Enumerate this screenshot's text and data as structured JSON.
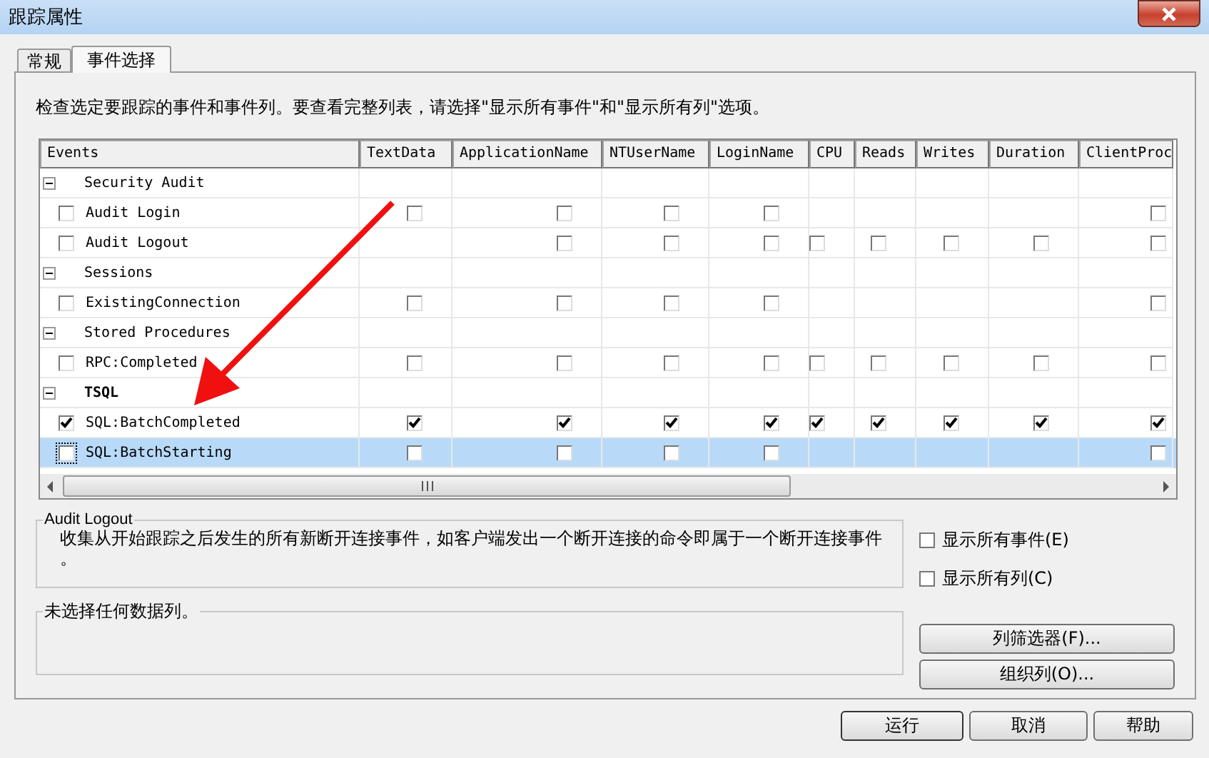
{
  "window": {
    "title": "跟踪属性"
  },
  "tabs": [
    {
      "label": "常规",
      "selected": false
    },
    {
      "label": "事件选择",
      "selected": true
    }
  ],
  "instructions": "检查选定要跟踪的事件和事件列。要查看完整列表，请选择\"显示所有事件\"和\"显示所有列\"选项。",
  "table": {
    "columns": [
      "Events",
      "TextData",
      "ApplicationName",
      "NTUserName",
      "LoginName",
      "CPU",
      "Reads",
      "Writes",
      "Duration",
      "ClientProc"
    ],
    "rows": [
      {
        "kind": "category",
        "label": "Security Audit",
        "expanded": true,
        "bold": false,
        "selected": false
      },
      {
        "kind": "event",
        "label": "Audit Login",
        "checked": false,
        "selected": false,
        "cells": [
          {
            "kind": "box",
            "checked": false
          },
          {
            "kind": "box",
            "checked": false
          },
          {
            "kind": "box",
            "checked": false
          },
          {
            "kind": "box",
            "checked": false
          },
          {
            "kind": "none"
          },
          {
            "kind": "none"
          },
          {
            "kind": "none"
          },
          {
            "kind": "none"
          },
          {
            "kind": "box",
            "checked": false
          }
        ]
      },
      {
        "kind": "event",
        "label": "Audit Logout",
        "checked": false,
        "selected": false,
        "cells": [
          {
            "kind": "none"
          },
          {
            "kind": "box",
            "checked": false
          },
          {
            "kind": "box",
            "checked": false
          },
          {
            "kind": "box",
            "checked": false
          },
          {
            "kind": "box",
            "checked": false
          },
          {
            "kind": "box",
            "checked": false
          },
          {
            "kind": "box",
            "checked": false
          },
          {
            "kind": "box",
            "checked": false
          },
          {
            "kind": "box",
            "checked": false
          }
        ]
      },
      {
        "kind": "category",
        "label": "Sessions",
        "expanded": true,
        "bold": false,
        "selected": false
      },
      {
        "kind": "event",
        "label": "ExistingConnection",
        "checked": false,
        "selected": false,
        "cells": [
          {
            "kind": "box",
            "checked": false
          },
          {
            "kind": "box",
            "checked": false
          },
          {
            "kind": "box",
            "checked": false
          },
          {
            "kind": "box",
            "checked": false
          },
          {
            "kind": "none"
          },
          {
            "kind": "none"
          },
          {
            "kind": "none"
          },
          {
            "kind": "none"
          },
          {
            "kind": "box",
            "checked": false
          }
        ]
      },
      {
        "kind": "category",
        "label": "Stored Procedures",
        "expanded": true,
        "bold": false,
        "selected": false
      },
      {
        "kind": "event",
        "label": "RPC:Completed",
        "checked": false,
        "selected": false,
        "cells": [
          {
            "kind": "box",
            "checked": false
          },
          {
            "kind": "box",
            "checked": false
          },
          {
            "kind": "box",
            "checked": false
          },
          {
            "kind": "box",
            "checked": false
          },
          {
            "kind": "box",
            "checked": false
          },
          {
            "kind": "box",
            "checked": false
          },
          {
            "kind": "box",
            "checked": false
          },
          {
            "kind": "box",
            "checked": false
          },
          {
            "kind": "box",
            "checked": false
          }
        ]
      },
      {
        "kind": "category",
        "label": "TSQL",
        "expanded": true,
        "bold": true,
        "selected": false
      },
      {
        "kind": "event",
        "label": "SQL:BatchCompleted",
        "checked": true,
        "selected": false,
        "cells": [
          {
            "kind": "box",
            "checked": true
          },
          {
            "kind": "box",
            "checked": true
          },
          {
            "kind": "box",
            "checked": true
          },
          {
            "kind": "box",
            "checked": true
          },
          {
            "kind": "box",
            "checked": true
          },
          {
            "kind": "box",
            "checked": true
          },
          {
            "kind": "box",
            "checked": true
          },
          {
            "kind": "box",
            "checked": true
          },
          {
            "kind": "box",
            "checked": true
          }
        ]
      },
      {
        "kind": "event",
        "label": "SQL:BatchStarting",
        "checked": false,
        "selected": true,
        "cells": [
          {
            "kind": "box",
            "checked": false
          },
          {
            "kind": "box",
            "checked": false
          },
          {
            "kind": "box",
            "checked": false
          },
          {
            "kind": "box",
            "checked": false
          },
          {
            "kind": "none"
          },
          {
            "kind": "none"
          },
          {
            "kind": "none"
          },
          {
            "kind": "none"
          },
          {
            "kind": "box",
            "checked": false
          }
        ]
      }
    ]
  },
  "description": {
    "title": "Audit Logout",
    "text": "收集从开始跟踪之后发生的所有新断开连接事件，如客户端发出一个断开连接的命令即属于一个断开连接事件。"
  },
  "options": [
    {
      "label": "显示所有事件(E)",
      "checked": false
    },
    {
      "label": "显示所有列(C)",
      "checked": false
    }
  ],
  "columns_info": {
    "title": "未选择任何数据列。"
  },
  "side_buttons": [
    "列筛选器(F)...",
    "组织列(O)..."
  ],
  "buttons": [
    "运行",
    "取消",
    "帮助"
  ]
}
